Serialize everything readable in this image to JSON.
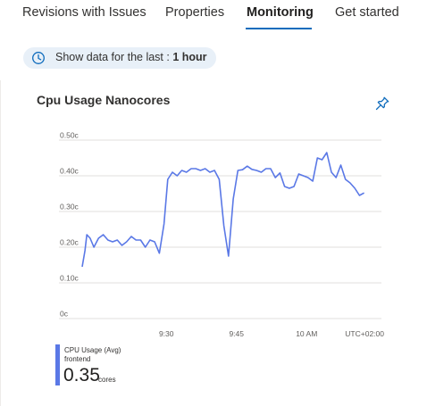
{
  "tabs": [
    {
      "label": "Revisions with Issues"
    },
    {
      "label": "Properties"
    },
    {
      "label": "Monitoring"
    },
    {
      "label": "Get started"
    }
  ],
  "time_range": {
    "prefix": "Show data for the last :",
    "value": "1 hour"
  },
  "card": {
    "title": "Cpu Usage Nanocores"
  },
  "colors": {
    "accent": "#0f6cbd",
    "series": "#5a78e6",
    "pill_bg": "#e8f0f8"
  },
  "icons": {
    "time": "clock-icon",
    "pin": "pin-icon"
  },
  "legend": {
    "series": "CPU Usage (Avg)",
    "sub": "frontend",
    "value": "0.35",
    "unit": "cores"
  },
  "chart_data": {
    "type": "line",
    "yticks": [
      "0.50c",
      "0.40c",
      "0.30c",
      "0.20c",
      "0.10c",
      "0c"
    ],
    "ytick_values": [
      0.5,
      0.4,
      0.3,
      0.2,
      0.1,
      0
    ],
    "xticks": [
      "9:30",
      "9:45",
      "10 AM"
    ],
    "xtick_minutes": [
      18,
      33,
      48
    ],
    "timezone_label": "UTC+02:00",
    "ylim": [
      0,
      0.5
    ],
    "xlim": [
      0,
      64
    ],
    "grid": true,
    "series": [
      {
        "name": "CPU Usage (Avg)",
        "x": [
          0,
          0.6,
          1,
          1.7,
          2.5,
          3.5,
          4.5,
          5.5,
          6.5,
          7.5,
          8.5,
          9.5,
          10.5,
          11.5,
          12.5,
          13.5,
          14.5,
          15.5,
          16.5,
          17.5,
          18.3,
          19.3,
          20.3,
          21.3,
          22.3,
          23.3,
          24.3,
          25.3,
          26.3,
          27.3,
          28.3,
          29.3,
          30.3,
          31.3,
          32.3,
          33.3,
          34.3,
          35.3,
          36.3,
          37.3,
          38.3,
          39.3,
          40.3,
          41.3,
          42.3,
          43.3,
          44.3,
          45.3,
          46.3,
          47.3,
          48.3,
          49.3,
          50.3,
          51.3,
          52.3,
          53.3,
          54.3,
          55.3,
          56.3,
          57.3,
          58.3,
          59.3,
          60.3
        ],
        "values": [
          0.145,
          0.19,
          0.235,
          0.225,
          0.2,
          0.225,
          0.235,
          0.22,
          0.215,
          0.22,
          0.205,
          0.215,
          0.23,
          0.22,
          0.22,
          0.2,
          0.22,
          0.215,
          0.183,
          0.265,
          0.39,
          0.41,
          0.4,
          0.415,
          0.41,
          0.42,
          0.42,
          0.415,
          0.42,
          0.41,
          0.415,
          0.39,
          0.26,
          0.175,
          0.335,
          0.415,
          0.417,
          0.427,
          0.418,
          0.415,
          0.41,
          0.42,
          0.42,
          0.395,
          0.408,
          0.37,
          0.365,
          0.37,
          0.405,
          0.4,
          0.395,
          0.385,
          0.45,
          0.445,
          0.465,
          0.41,
          0.395,
          0.43,
          0.39,
          0.38,
          0.365,
          0.345,
          0.352
        ]
      }
    ]
  }
}
